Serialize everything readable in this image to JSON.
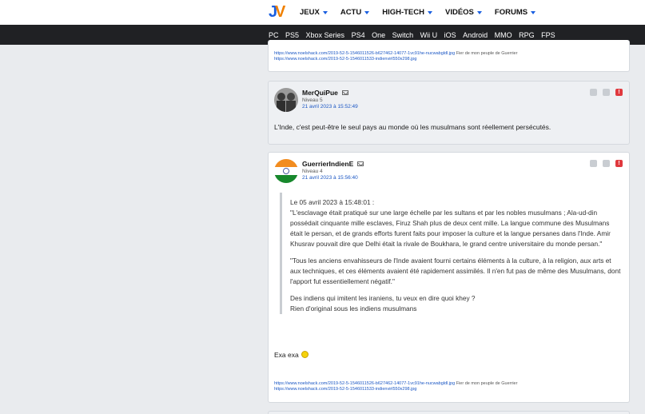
{
  "header": {
    "logo_text": "JV",
    "nav": [
      "JEUX",
      "ACTU",
      "HIGH-TECH",
      "VIDÉOS",
      "FORUMS"
    ],
    "platforms": [
      "PC",
      "PS5",
      "Xbox Series",
      "PS4",
      "One",
      "Switch",
      "Wii U",
      "iOS",
      "Android",
      "MMO",
      "RPG",
      "FPS"
    ]
  },
  "prev_post": {
    "sig_line1": "https://www.noelshack.com/2019-52-5-1546011526-b627462-14077-1vc91he-nucwabgldl.jpg",
    "sig_line1_tail": "Fier de mon peuple de Guerrier",
    "sig_line2": "https://www.noelshack.com/2019-52-5-1546011533-indienvirl550x298.jpg"
  },
  "post1": {
    "pseudo": "MerQuiPue",
    "niveau": "Niveau 5",
    "date": "21 avril 2023 à 15:52:49",
    "body": "L'Inde, c'est peut-être le seul pays au monde où les musulmans sont réellement persécutés."
  },
  "post2": {
    "pseudo": "GuerrierIndienE",
    "niveau": "Niveau 4",
    "date": "21 avril 2023 à 15:56:40",
    "quote_date": "Le 05 avril 2023 à 15:48:01 :",
    "quote_p1": "\"L'esclavage était pratiqué sur une large échelle par les sultans et par les nobles musulmans ; Ala-ud-din possédait cinquante mille esclaves, Firuz Shah plus de deux cent mille. La langue commune des Musulmans était le persan, et de grands efforts furent faits pour imposer la culture et la langue persanes dans l'Inde. Amir Khusrav pouvait dire que Delhi était la rivale de Boukhara, le grand centre universitaire du monde persan.\"",
    "quote_p2": "\"Tous les anciens envahisseurs de l'Inde avaient fourni certains éléments à la culture, à la religion, aux arts et aux techniques, et ces éléments avaient été rapidement assimilés. Il n'en fut pas de même des Musulmans, dont l'apport fut essentiellement négatif.\"",
    "quote_p3a": "Des indiens qui imitent les iraniens, tu veux en dire quoi khey ?",
    "quote_p3b": "Rien d'original sous les indiens musulmans",
    "body": "Exa exa",
    "sig_line1": "https://www.noelshack.com/2019-52-5-1546011526-b627462-14077-1vc91he-nucwabgldl.jpg",
    "sig_line1_tail": "Fier de mon peuple de Guerrier",
    "sig_line2": "https://www.noelshack.com/2019-52-5-1546011533-indienvirl550x298.jpg"
  },
  "colors": {
    "accent": "#1a56c4",
    "logo_blue": "#1a5fe0",
    "logo_orange": "#f08000",
    "alert": "#e0393e"
  }
}
